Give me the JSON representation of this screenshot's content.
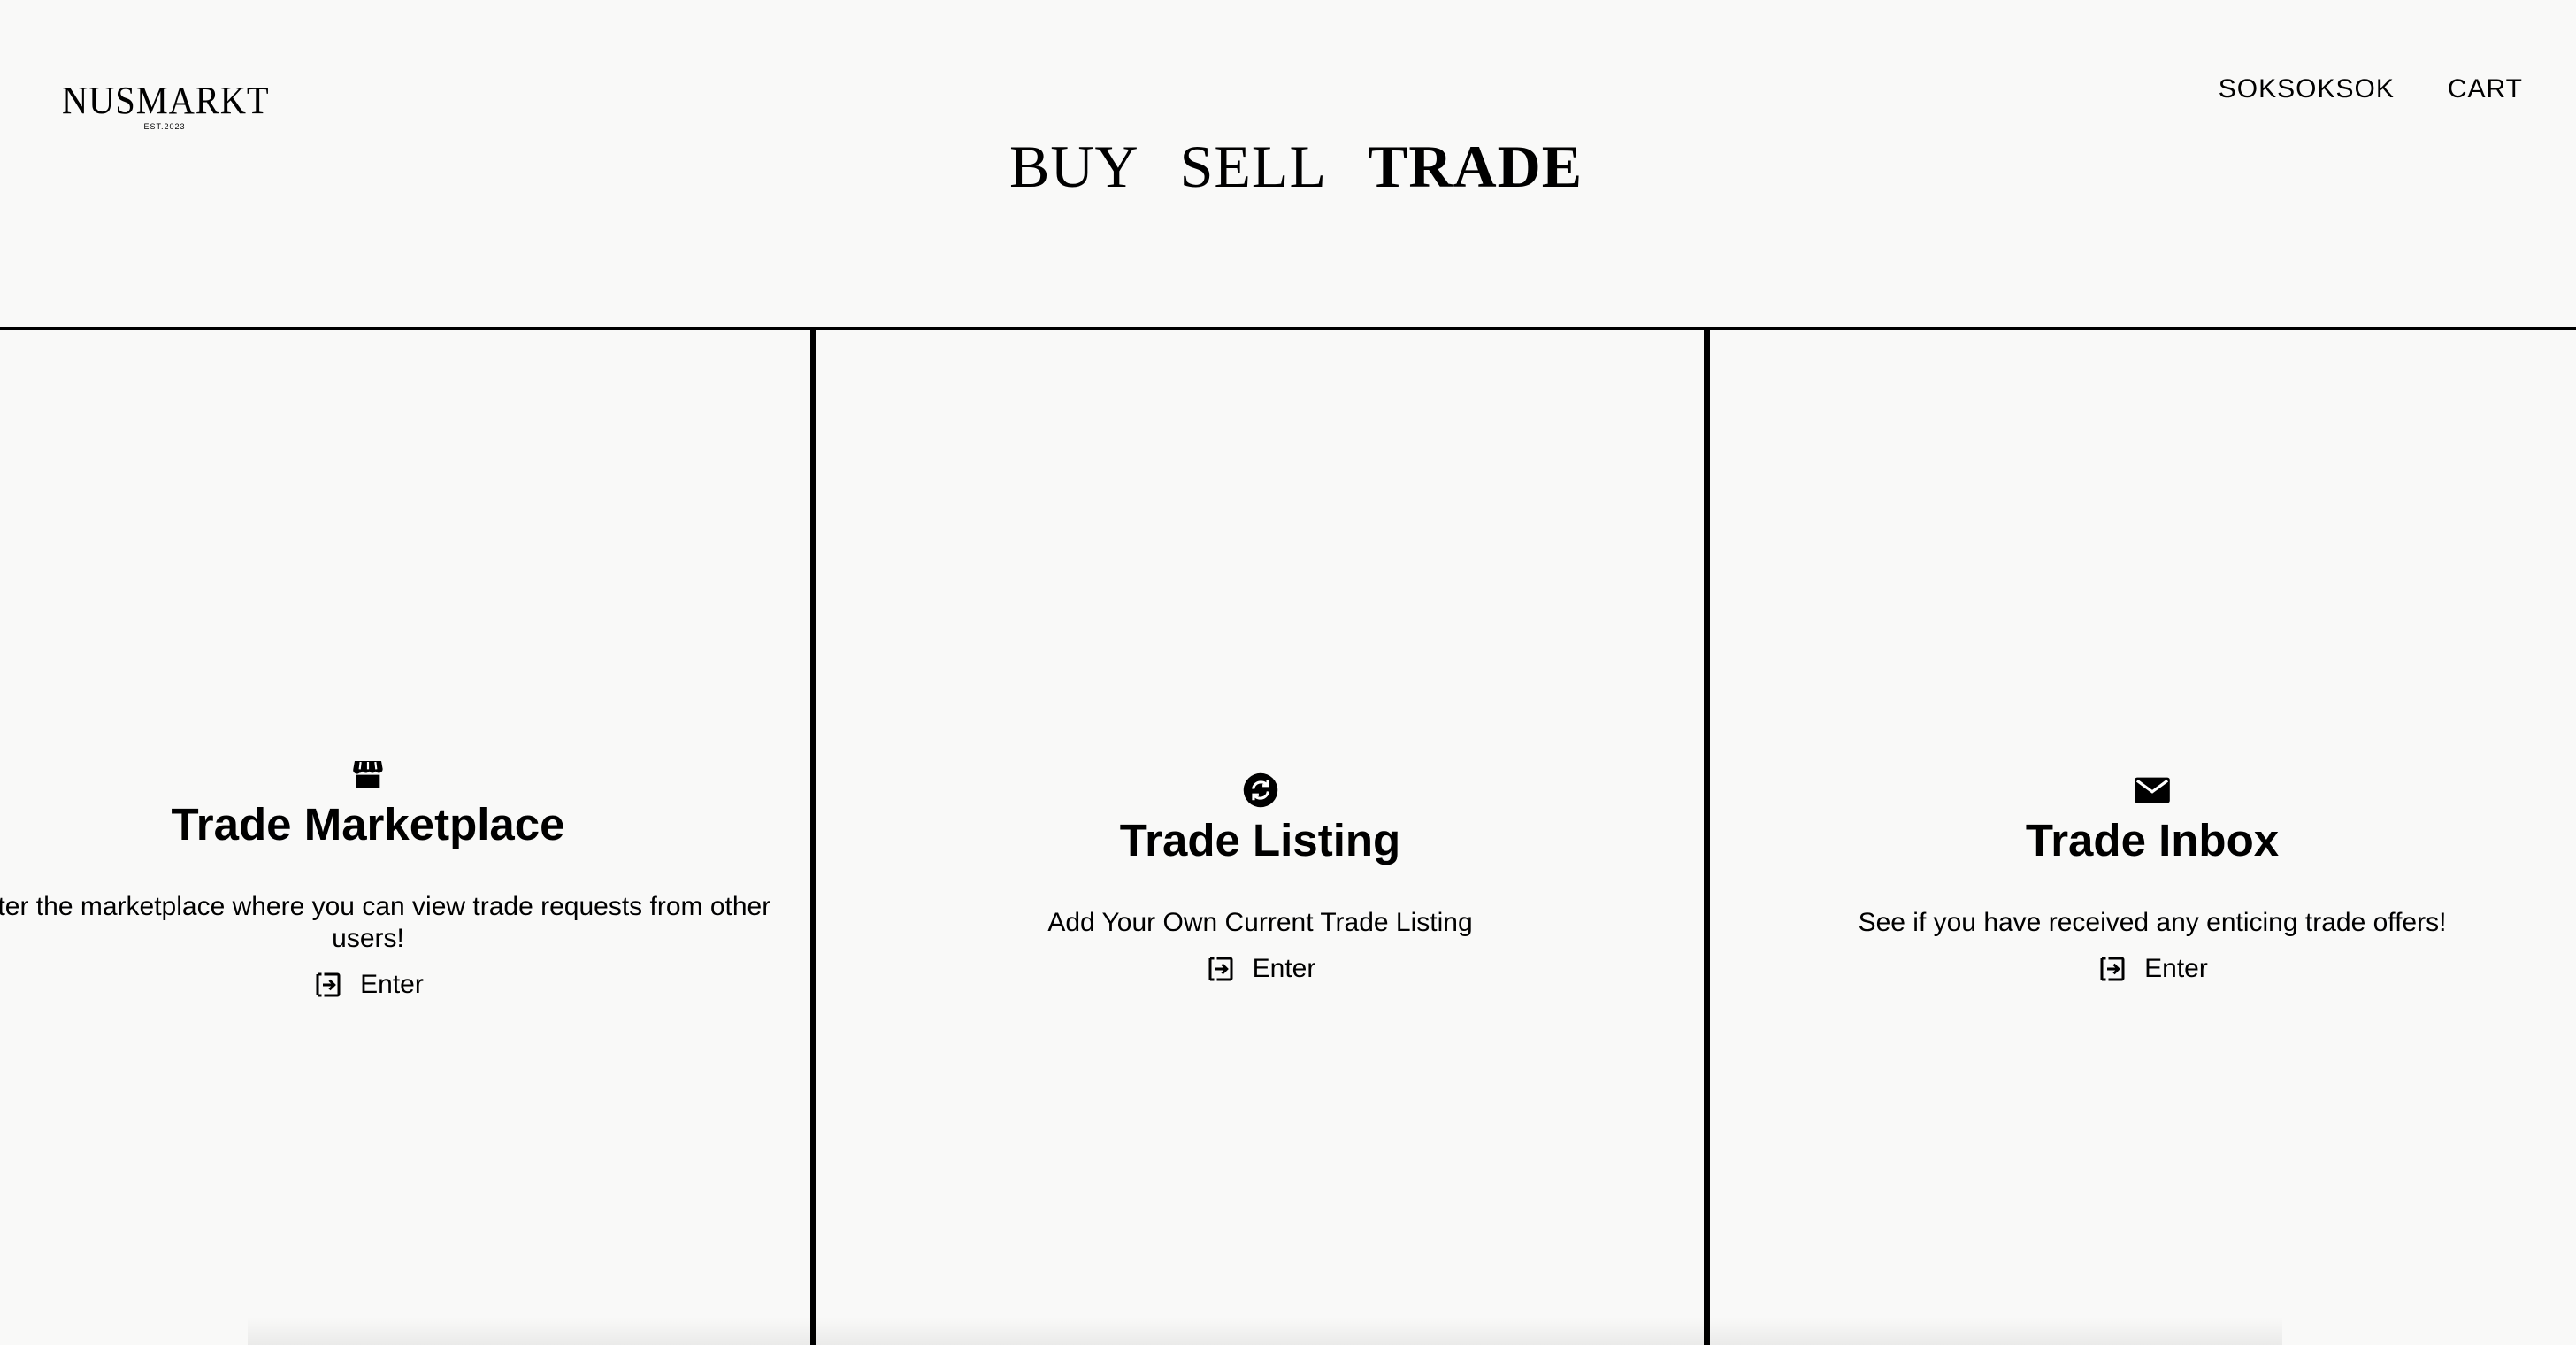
{
  "logo": {
    "wordmark": "NUSMARKT",
    "established": "EST.2023"
  },
  "top_nav": {
    "user_label": "SOKSOKSOK",
    "cart_label": "CART"
  },
  "mode_nav": {
    "buy": "BUY",
    "sell": "SELL",
    "trade": "TRADE",
    "active": "TRADE"
  },
  "panels": [
    {
      "icon": "storefront-icon",
      "title": "Trade Marketplace",
      "description": "Enter the marketplace where you can view trade requests from other users!",
      "enter_label": "Enter"
    },
    {
      "icon": "refresh-circle-icon",
      "title": "Trade Listing",
      "description": "Add Your Own Current Trade Listing",
      "enter_label": "Enter"
    },
    {
      "icon": "mail-icon",
      "title": "Trade Inbox",
      "description": "See if you have received any enticing trade offers!",
      "enter_label": "Enter"
    }
  ]
}
